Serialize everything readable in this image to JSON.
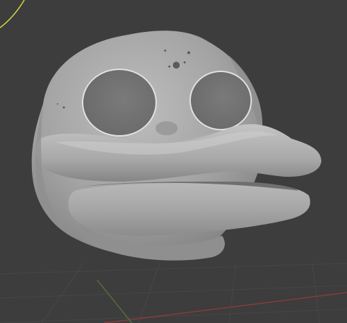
{
  "viewport": {
    "background": "#3d3d3d",
    "grid_color": "#474747",
    "x_axis_color": "#8a3a3a",
    "y_axis_color": "#5a7a3a",
    "selection_outline_color": "#d9d93a",
    "object": "sculpted-head-mesh"
  }
}
